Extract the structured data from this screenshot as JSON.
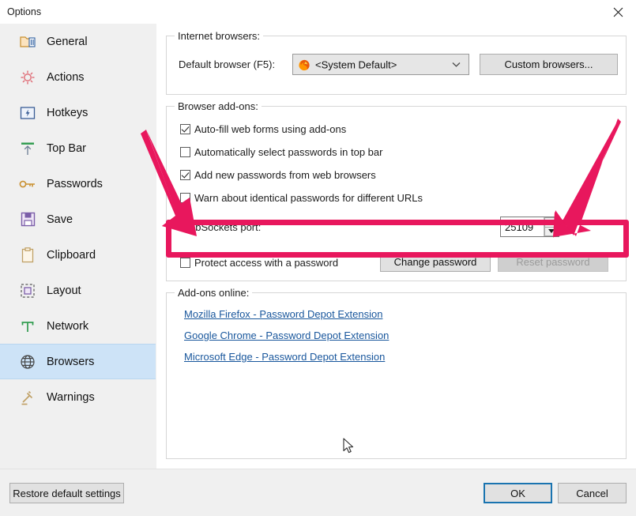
{
  "window": {
    "title": "Options",
    "close_icon": "close-icon"
  },
  "sidebar": {
    "items": [
      {
        "label": "General",
        "icon": "folder-tools-icon",
        "selected": false
      },
      {
        "label": "Actions",
        "icon": "gear-icon",
        "selected": false
      },
      {
        "label": "Hotkeys",
        "icon": "keyboard-bolt-icon",
        "selected": false
      },
      {
        "label": "Top Bar",
        "icon": "arrow-up-bar-icon",
        "selected": false
      },
      {
        "label": "Passwords",
        "icon": "key-icon",
        "selected": false
      },
      {
        "label": "Save",
        "icon": "floppy-disk-icon",
        "selected": false
      },
      {
        "label": "Clipboard",
        "icon": "clipboard-icon",
        "selected": false
      },
      {
        "label": "Layout",
        "icon": "layout-icon",
        "selected": false
      },
      {
        "label": "Network",
        "icon": "network-icon",
        "selected": false
      },
      {
        "label": "Browsers",
        "icon": "globe-icon",
        "selected": true
      },
      {
        "label": "Warnings",
        "icon": "gavel-icon",
        "selected": false
      }
    ]
  },
  "main": {
    "internet_browsers": {
      "title": "Internet browsers:",
      "default_browser_label": "Default browser (F5):",
      "default_browser_value": "<System Default>",
      "default_browser_icon": "firefox-icon",
      "dropdown_icon": "chevron-down-icon",
      "custom_browsers_button": "Custom browsers..."
    },
    "browser_addons": {
      "title": "Browser add-ons:",
      "checkboxes": [
        {
          "label": "Auto-fill web forms using add-ons",
          "checked": true
        },
        {
          "label": "Automatically select passwords in top bar",
          "checked": false
        },
        {
          "label": "Add new passwords from web browsers",
          "checked": true
        },
        {
          "label": "Warn about identical passwords for different URLs",
          "checked": false
        }
      ],
      "websockets_label": "WebSockets port:",
      "websockets_value": "25109",
      "spinner_up_icon": "spinner-up-icon",
      "spinner_down_icon": "spinner-down-icon",
      "protect_checkbox": {
        "label": "Protect access with a password",
        "checked": false
      },
      "change_password_button": "Change password",
      "reset_password_button": "Reset password",
      "reset_password_disabled": true
    },
    "addons_online": {
      "title": "Add-ons online:",
      "links": [
        "Mozilla Firefox - Password Depot Extension",
        "Google Chrome - Password Depot Extension",
        "Microsoft Edge - Password Depot Extension"
      ]
    }
  },
  "footer": {
    "restore_defaults_button": "Restore default settings",
    "ok_button": "OK",
    "cancel_button": "Cancel"
  },
  "annotations": {
    "highlight_color": "#e8175d",
    "arrow_left": "arrow-pointing-down-right-icon",
    "arrow_right": "arrow-pointing-down-left-icon",
    "cursor": "mouse-pointer-icon"
  }
}
